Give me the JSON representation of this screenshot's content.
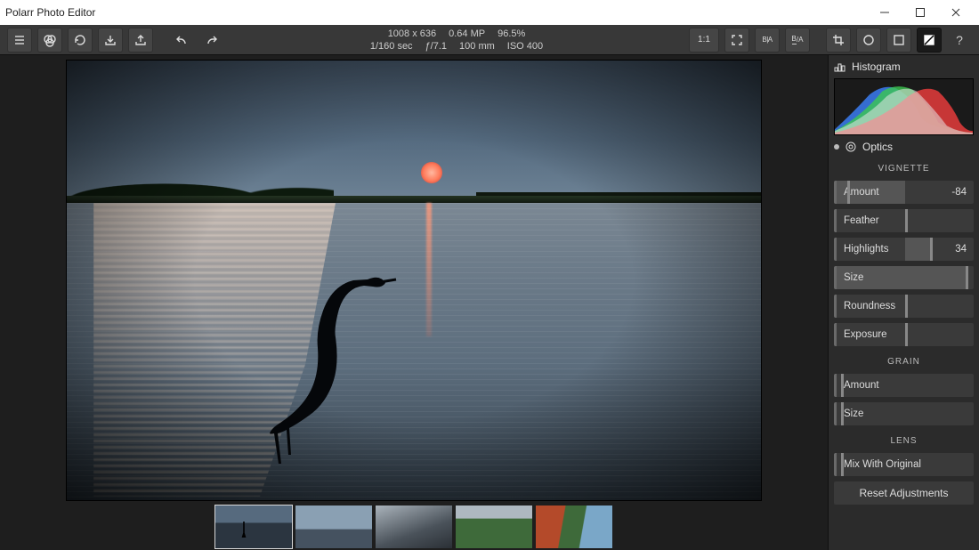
{
  "window": {
    "title": "Polarr Photo Editor"
  },
  "meta": {
    "dimensions": "1008 x 636",
    "megapixels": "0.64 MP",
    "zoom": "96.5%",
    "shutter": "1/160 sec",
    "aperture": "ƒ/7.1",
    "focal": "100 mm",
    "iso": "ISO 400"
  },
  "toolbar": {
    "left_icons": [
      "menu",
      "adjust",
      "history",
      "download",
      "share",
      "undo",
      "redo"
    ],
    "right_icons": [
      "oneToOne",
      "fullscreen",
      "beforeAfterH",
      "beforeAfterV",
      "crop",
      "circle",
      "square",
      "negative",
      "help"
    ]
  },
  "sidebar": {
    "histogram_label": "Histogram",
    "optics_label": "Optics",
    "sections": {
      "vignette": {
        "label": "VIGNETTE",
        "sliders": [
          {
            "label": "Amount",
            "value": "-84",
            "fill": 8,
            "handle": 8
          },
          {
            "label": "Feather",
            "value": "",
            "fill": 50,
            "handle": 50
          },
          {
            "label": "Highlights",
            "value": "34",
            "fill": 68,
            "handle": 68
          },
          {
            "label": "Size",
            "value": "",
            "fill": 94,
            "handle": 94
          },
          {
            "label": "Roundness",
            "value": "",
            "fill": 50,
            "handle": 50
          },
          {
            "label": "Exposure",
            "value": "",
            "fill": 50,
            "handle": 50
          }
        ]
      },
      "grain": {
        "label": "GRAIN",
        "sliders": [
          {
            "label": "Amount",
            "value": "",
            "fill": 3,
            "handle": 3
          },
          {
            "label": "Size",
            "value": "",
            "fill": 3,
            "handle": 3
          }
        ]
      },
      "lens": {
        "label": "LENS",
        "sliders": [
          {
            "label": "Mix With Original",
            "value": "",
            "fill": 3,
            "handle": 3
          }
        ]
      }
    },
    "reset_label": "Reset Adjustments"
  },
  "filmstrip": {
    "count": 5,
    "selected": 0
  }
}
